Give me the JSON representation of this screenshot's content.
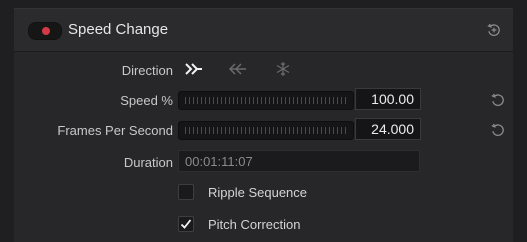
{
  "header": {
    "title": "Speed Change",
    "enabled": true,
    "toggle_color": "#d23b45",
    "reset_icon": "reset-icon"
  },
  "direction": {
    "label": "Direction",
    "options": [
      {
        "name": "forward",
        "icon": "double-chevron-right-icon",
        "selected": true
      },
      {
        "name": "reverse",
        "icon": "double-arrow-left-icon",
        "selected": false
      },
      {
        "name": "freeze",
        "icon": "snowflake-icon",
        "selected": false
      }
    ]
  },
  "speed": {
    "label": "Speed %",
    "value": "100.00",
    "reset_icon": "reset-icon"
  },
  "fps": {
    "label": "Frames Per Second",
    "value": "24.000",
    "reset_icon": "reset-icon"
  },
  "duration": {
    "label": "Duration",
    "value": "00:01:11:07"
  },
  "ripple_sequence": {
    "label": "Ripple Sequence",
    "checked": false
  },
  "pitch_correction": {
    "label": "Pitch Correction",
    "checked": true
  }
}
